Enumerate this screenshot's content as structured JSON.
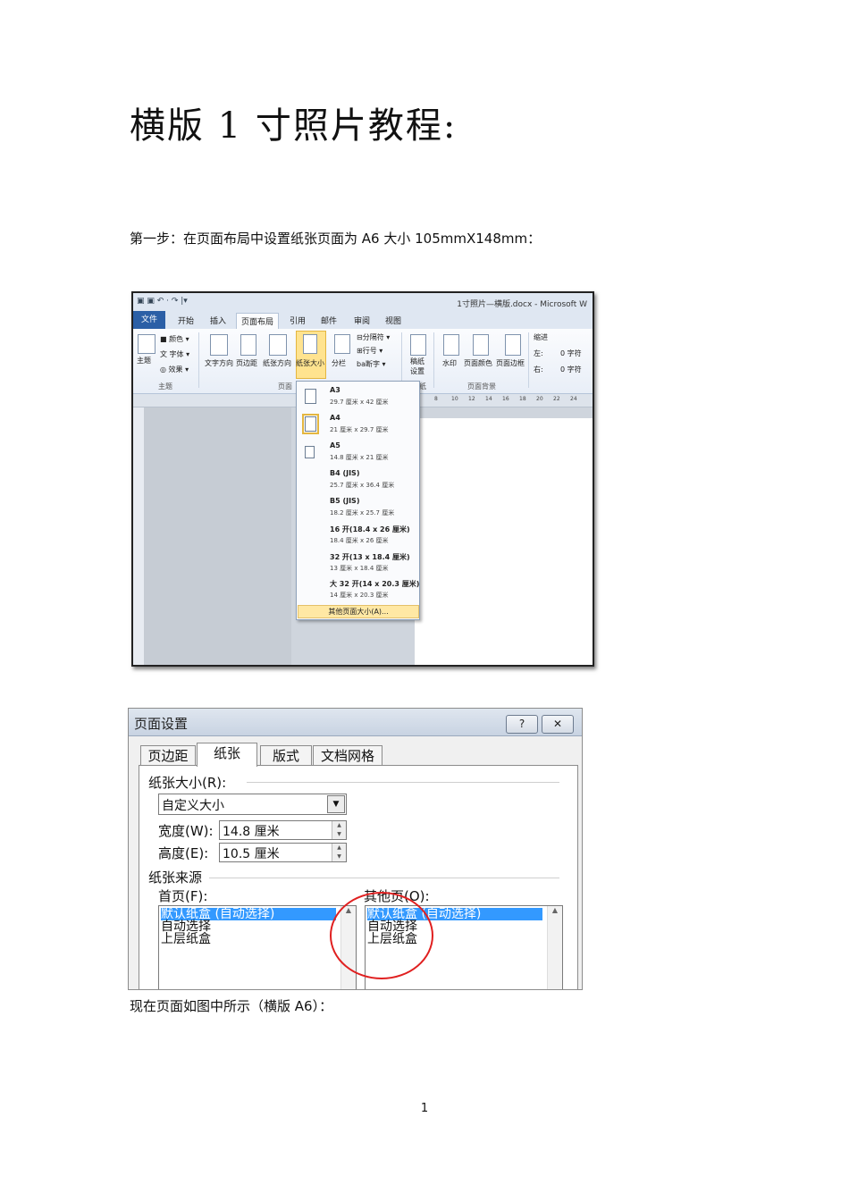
{
  "title": "横版 1 寸照片教程:",
  "step1": "第一步：在页面布局中设置纸张页面为 A6 大小 105mmX148mm：",
  "note_after": "现在页面如图中所示（横版 A6）：",
  "page_number": "1",
  "word_screenshot": {
    "window_title": "1寸照片—横版.docx - Microsoft W",
    "tabs": [
      "文件",
      "开始",
      "插入",
      "页面布局",
      "引用",
      "邮件",
      "审阅",
      "视图"
    ],
    "ribbon": {
      "theme_group": {
        "themes": "主题",
        "colors": "颜色",
        "fonts": "字体",
        "effects": "效果",
        "label": "主题"
      },
      "page_setup_group": {
        "text_direction": "文字方向",
        "margins": "页边距",
        "orientation": "纸张方向",
        "size": "纸张大小",
        "columns": "分栏",
        "breaks": "分隔符",
        "line_numbers": "行号",
        "hyphenation": "断字",
        "label": "页面"
      },
      "draft": {
        "line1": "稿纸",
        "line2": "设置",
        "label": "纸"
      },
      "background_group": {
        "watermark": "水印",
        "page_color": "页面颜色",
        "page_borders": "页面边框",
        "label": "页面背景"
      },
      "indent": {
        "title": "缩进",
        "left": "左:",
        "right": "右:",
        "value": "0 字符"
      }
    },
    "ruler_ticks": [
      "8",
      "10",
      "12",
      "14",
      "16",
      "18",
      "20",
      "22",
      "24"
    ],
    "paper_sizes": [
      {
        "name": "A3",
        "dim": "29.7 厘米 x 42 厘米"
      },
      {
        "name": "A4",
        "dim": "21 厘米 x 29.7 厘米"
      },
      {
        "name": "A5",
        "dim": "14.8 厘米 x 21 厘米"
      },
      {
        "name": "B4 (JIS)",
        "dim": "25.7 厘米 x 36.4 厘米"
      },
      {
        "name": "B5 (JIS)",
        "dim": "18.2 厘米 x 25.7 厘米"
      },
      {
        "name": "16 开(18.4 x 26 厘米)",
        "dim": "18.4 厘米 x 26 厘米"
      },
      {
        "name": "32 开(13 x 18.4 厘米)",
        "dim": "13 厘米 x 18.4 厘米"
      },
      {
        "name": "大 32 开(14 x 20.3 厘米)",
        "dim": "14 厘米 x 20.3 厘米"
      }
    ],
    "more_sizes": "其他页面大小(A)..."
  },
  "dialog": {
    "title": "页面设置",
    "help": "?",
    "close": "✕",
    "tabs": [
      "页边距",
      "纸张",
      "版式",
      "文档网格"
    ],
    "paper_size_label": "纸张大小(R):",
    "paper_size_value": "自定义大小",
    "width_label": "宽度(W):",
    "width_value": "14.8  厘米",
    "height_label": "高度(E):",
    "height_value": "10.5  厘米",
    "paper_source": "纸张来源",
    "first_page_label": "首页(F):",
    "other_pages_label": "其他页(O):",
    "trays": [
      "默认纸盒 (自动选择)",
      "自动选择",
      "上层纸盒"
    ]
  }
}
